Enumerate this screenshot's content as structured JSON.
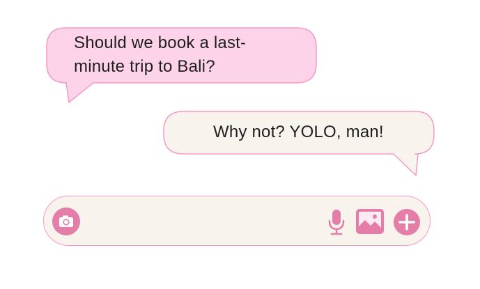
{
  "conversation": {
    "incoming_message": "Should we book a last-minute trip to Bali?",
    "outgoing_message": "Why not? YOLO, man!"
  },
  "composer": {
    "input_value": "",
    "icons": [
      "camera-icon",
      "microphone-icon",
      "image-icon",
      "plus-icon"
    ]
  },
  "colors": {
    "incoming_bubble": "#fdd3ea",
    "outgoing_bubble": "#f8f3ec",
    "border": "#f59ac7",
    "icon_accent": "#e47ea8",
    "text": "#1f1f1f"
  }
}
